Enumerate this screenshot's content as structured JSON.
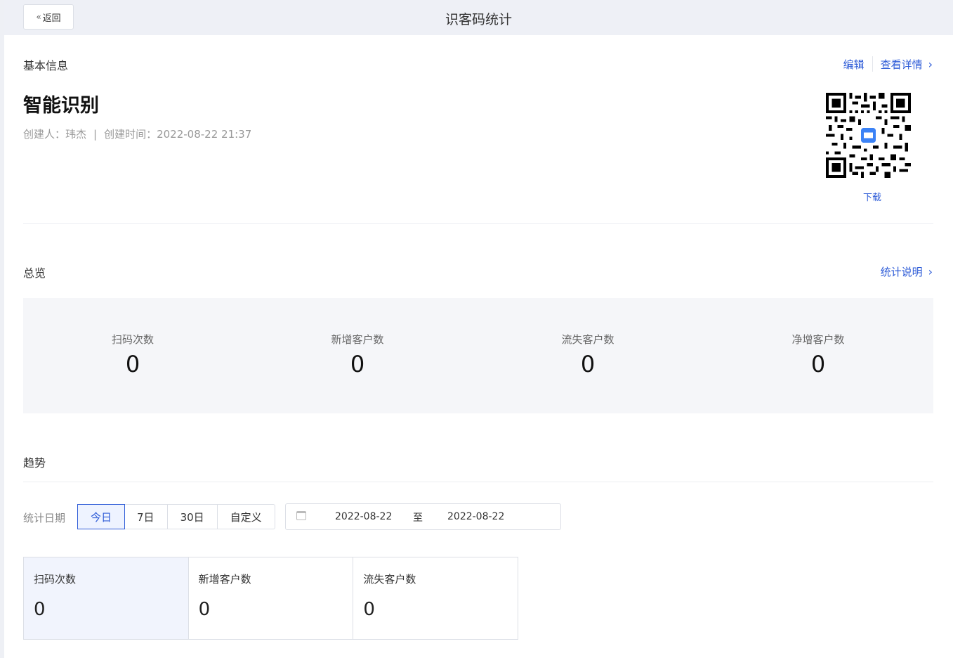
{
  "header": {
    "back_label": "返回",
    "title": "识客码统计"
  },
  "basic": {
    "section_title": "基本信息",
    "edit_label": "编辑",
    "detail_label": "查看详情",
    "name": "智能识别",
    "creator_label": "创建人：玮杰",
    "created_label": "创建时间：2022-08-22 21:37",
    "download_label": "下载"
  },
  "overview": {
    "section_title": "总览",
    "help_label": "统计说明",
    "items": [
      {
        "label": "扫码次数",
        "value": "0"
      },
      {
        "label": "新增客户数",
        "value": "0"
      },
      {
        "label": "流失客户数",
        "value": "0"
      },
      {
        "label": "净增客户数",
        "value": "0"
      }
    ]
  },
  "trend": {
    "section_title": "趋势",
    "filter_label": "统计日期",
    "options": [
      "今日",
      "7日",
      "30日",
      "自定义"
    ],
    "selected_option": "今日",
    "date_start": "2022-08-22",
    "date_separator": "至",
    "date_end": "2022-08-22",
    "cards": [
      {
        "label": "扫码次数",
        "value": "0"
      },
      {
        "label": "新增客户数",
        "value": "0"
      },
      {
        "label": "流失客户数",
        "value": "0"
      }
    ],
    "active_card": "扫码次数"
  },
  "colors": {
    "accent": "#2d5bd7",
    "background": "#eef0f5",
    "panel": "#f5f6f9"
  }
}
